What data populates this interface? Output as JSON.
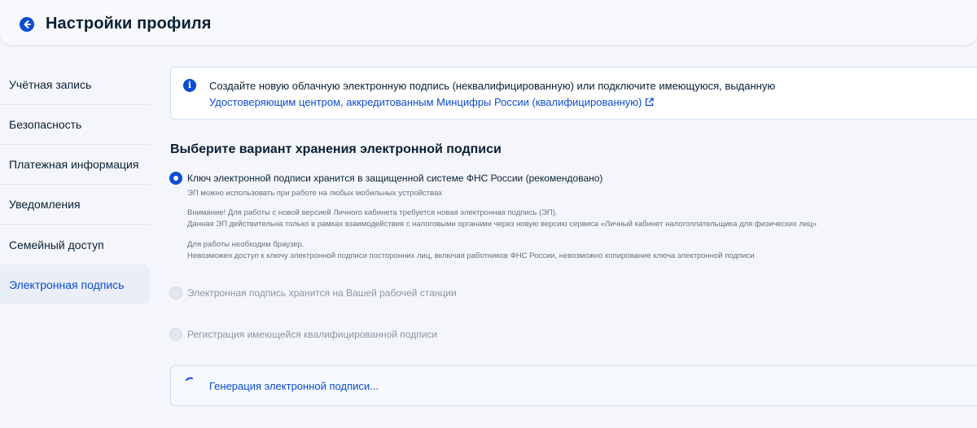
{
  "header": {
    "title": "Настройки профиля"
  },
  "sidebar": {
    "items": [
      {
        "label": "Учётная запись"
      },
      {
        "label": "Безопасность"
      },
      {
        "label": "Платежная информация"
      },
      {
        "label": "Уведомления"
      },
      {
        "label": "Семейный доступ"
      },
      {
        "label": "Электронная подпись"
      }
    ],
    "active_index": 5
  },
  "info": {
    "text": "Создайте новую облачную электронную подпись (неквалифицированную) или подключите имеющуюся, выданную",
    "link": "Удостоверяющим центром, аккредитованным Минцифры России (квалифицированную)"
  },
  "section": {
    "title": "Выберите вариант хранения электронной подписи"
  },
  "options": [
    {
      "label": "Ключ электронной подписи хранится в защищенной системе ФНС России (рекомендовано)",
      "checked": true,
      "descriptions": [
        "ЭП можно использовать при работе на любых мобильных устройствах",
        "Внимание! Для работы с новой версией Личного кабинета требуется новая электронная подпись (ЭП).",
        "Данная ЭП действительна только в рамках взаимодействия с налоговыми органами через новую версию сервиса «Личный кабинет налогоплательщика для физических лиц»",
        "Для работы необходим браузер.",
        "Невозможен доступ к ключу электронной подписи посторонних лиц, включая работников ФНС России, невозможно копирование ключа электронной подписи"
      ]
    },
    {
      "label": "Электронная подпись хранится на Вашей рабочей станции",
      "checked": false,
      "disabled": true
    },
    {
      "label": "Регистрация имеющейся квалифицированной подписи",
      "checked": false,
      "disabled": true
    }
  ],
  "status": {
    "text": "Генерация электронной подписи..."
  },
  "colors": {
    "accent": "#0d4cd3",
    "text": "#0b1f33",
    "muted": "#66727f",
    "background": "#f4f6fb",
    "border": "#cfe0ee"
  },
  "icons": {
    "back": "arrow-left-circle-icon",
    "info": "info-icon",
    "external": "external-link-icon",
    "spinner": "loading-spinner-icon"
  }
}
